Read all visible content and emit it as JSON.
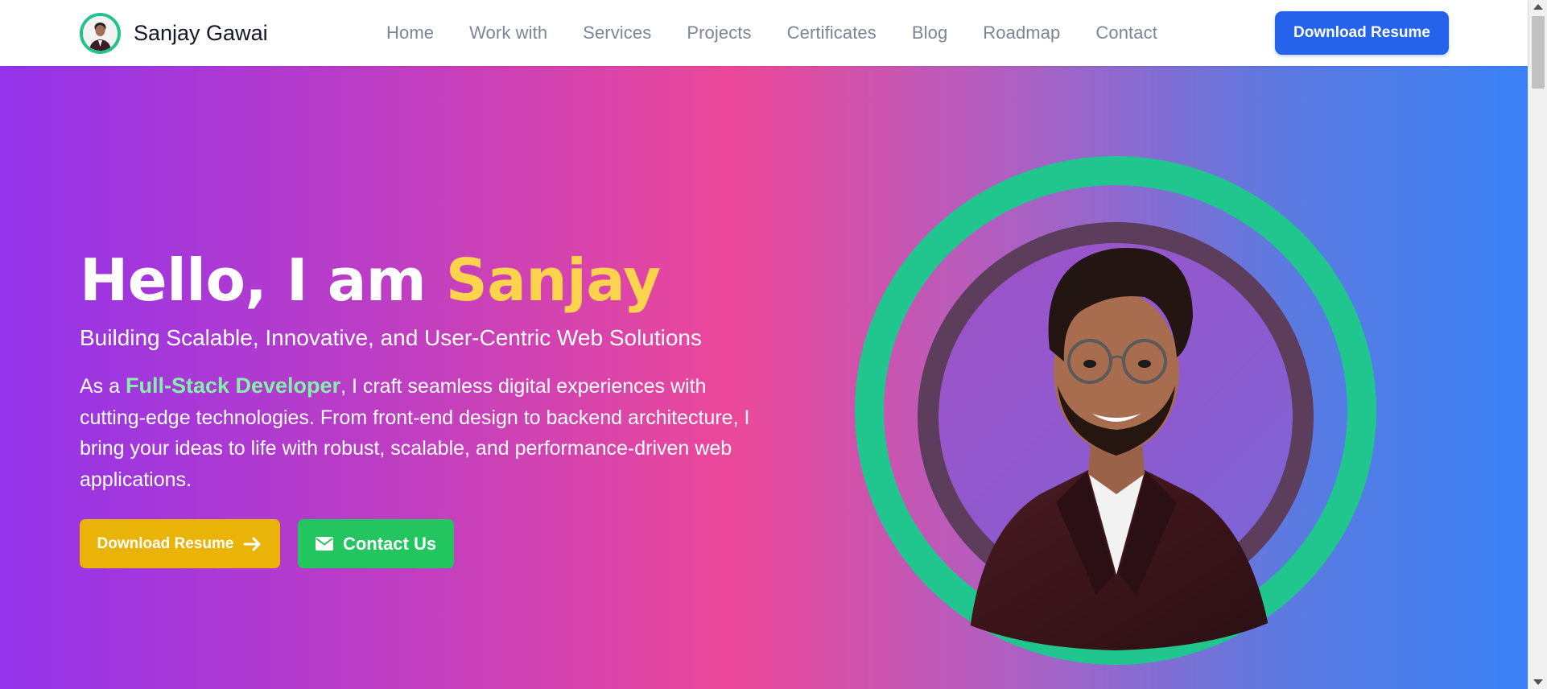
{
  "brand": {
    "name": "Sanjay Gawai",
    "avatar_icon": "profile-photo"
  },
  "nav": {
    "links": [
      {
        "label": "Home"
      },
      {
        "label": "Work with"
      },
      {
        "label": "Services"
      },
      {
        "label": "Projects"
      },
      {
        "label": "Certificates"
      },
      {
        "label": "Blog"
      },
      {
        "label": "Roadmap"
      },
      {
        "label": "Contact"
      }
    ],
    "download_button": "Download Resume"
  },
  "hero": {
    "title_prefix": "Hello, I am ",
    "title_name": "Sanjay",
    "subtitle": "Building Scalable, Innovative, and User-Centric Web Solutions",
    "para_prefix": "As a ",
    "para_highlight": "Full-Stack Developer",
    "para_rest": ", I craft seamless digital experiences with cutting-edge technologies. From front-end design to backend architecture, I bring your ideas to life with robust, scalable, and performance-driven web applications.",
    "download_button": "Download Resume",
    "download_icon": "arrow-right-icon",
    "contact_button": "Contact Us",
    "contact_icon": "envelope-icon"
  },
  "colors": {
    "brand_blue": "#2563eb",
    "accent_yellow": "#fcd34d",
    "highlight_green": "#86efac",
    "button_yellow": "#eab308",
    "button_green": "#22c55e",
    "ring_green": "#21c68f"
  }
}
